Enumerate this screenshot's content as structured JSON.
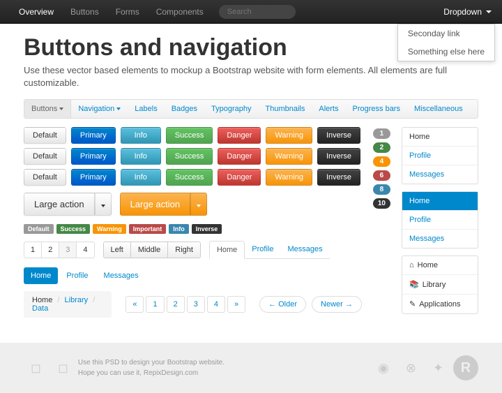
{
  "navbar": {
    "items": [
      "Overview",
      "Buttons",
      "Forms",
      "Components"
    ],
    "search_placeholder": "Search",
    "dropdown_label": "Dropdown",
    "dropdown_items": [
      "Seconday link",
      "Something else here"
    ]
  },
  "page": {
    "title": "Buttons and navigation",
    "lead": "Use these vector based elements to mockup a Bootstrap website with form elements. All elements are full customizable."
  },
  "subnav": [
    "Buttons",
    "Navigation",
    "Labels",
    "Badges",
    "Typography",
    "Thumbnails",
    "Alerts",
    "Progress bars",
    "Miscellaneous"
  ],
  "buttons": {
    "variants": [
      "Default",
      "Primary",
      "Info",
      "Success",
      "Danger",
      "Warning",
      "Inverse"
    ]
  },
  "badges": [
    "1",
    "2",
    "4",
    "6",
    "8",
    "10"
  ],
  "labels": [
    "Default",
    "Success",
    "Warning",
    "Important",
    "Info",
    "Inverse"
  ],
  "large_action": "Large action",
  "navlist1": [
    "Home",
    "Profile",
    "Messages"
  ],
  "navlist2": [
    "Home",
    "Profile",
    "Messages"
  ],
  "navlist3": [
    {
      "icon": "⌂",
      "label": "Home"
    },
    {
      "icon": "📚",
      "label": "Library"
    },
    {
      "icon": "✎",
      "label": "Applications"
    }
  ],
  "pagination": [
    "1",
    "2",
    "3",
    "4"
  ],
  "btngroup": [
    "Left",
    "Middle",
    "Right"
  ],
  "tabs": [
    "Home",
    "Profile",
    "Messages"
  ],
  "breadcrumb": [
    "Home",
    "Library",
    "Data"
  ],
  "pag2": [
    "«",
    "1",
    "2",
    "3",
    "4",
    "»"
  ],
  "pager": {
    "older": "← Older",
    "newer": "Newer →"
  },
  "footer": {
    "line1": "Use this PSD to design your Bootstrap website.",
    "line2": "Hope you can use it, ",
    "link": "RepixDesign.com"
  }
}
